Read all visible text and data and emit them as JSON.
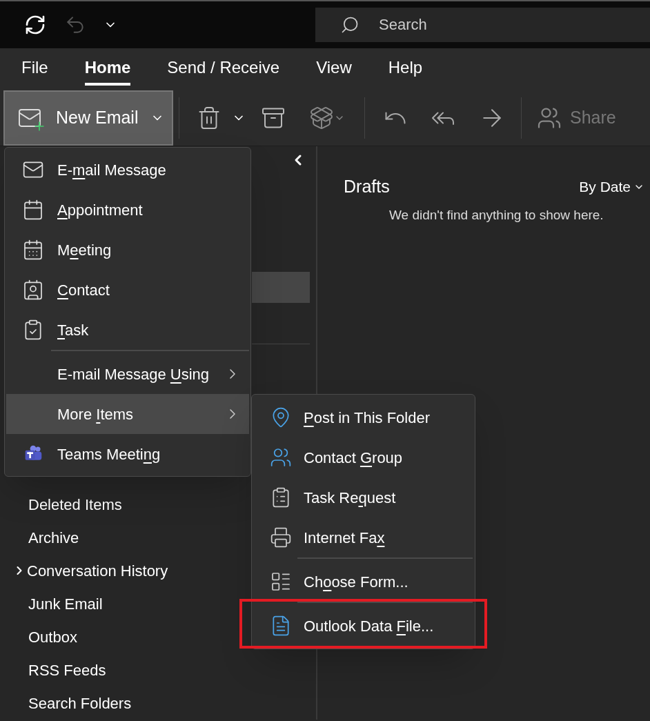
{
  "title_bar": {
    "search": {
      "placeholder": "Search"
    },
    "undo_disabled": true
  },
  "ribbon_tabs": [
    {
      "label": "File",
      "selected": false
    },
    {
      "label": "Home",
      "selected": true
    },
    {
      "label": "Send / Receive",
      "selected": false
    },
    {
      "label": "View",
      "selected": false
    },
    {
      "label": "Help",
      "selected": false
    }
  ],
  "toolbar": {
    "new_email": {
      "label": "New Email",
      "pressed": true
    },
    "share": {
      "label": "Share",
      "disabled": true
    }
  },
  "new_menu": {
    "items": [
      {
        "label": {
          "before": "E-",
          "key": "m",
          "after": "ail Message"
        },
        "selected": false,
        "submenu": false,
        "separator_before": false
      },
      {
        "label": {
          "key": "A",
          "after": "ppointment"
        },
        "selected": false,
        "submenu": false,
        "separator_before": false
      },
      {
        "label": {
          "before": "M",
          "key": "e",
          "after": "eting"
        },
        "selected": false,
        "submenu": false,
        "separator_before": false
      },
      {
        "label": {
          "key": "C",
          "after": "ontact"
        },
        "selected": false,
        "submenu": false,
        "separator_before": false
      },
      {
        "label": {
          "key": "T",
          "after": "ask"
        },
        "selected": false,
        "submenu": false,
        "separator_before": false
      },
      {
        "label": {
          "before": "E-mail Message ",
          "key": "U",
          "after": "sing"
        },
        "selected": false,
        "submenu": true,
        "separator_before": true
      },
      {
        "label": {
          "before": "More ",
          "key": "I",
          "after": "tems"
        },
        "selected": true,
        "submenu": true,
        "separator_before": false
      },
      {
        "label": {
          "before": "Teams Meeti",
          "key": "n",
          "after": "g"
        },
        "selected": false,
        "submenu": false,
        "separator_before": false
      }
    ]
  },
  "more_items_menu": {
    "items": [
      {
        "label": {
          "key": "P",
          "after": "ost in This Folder"
        },
        "separator_before": false,
        "highlighted": false
      },
      {
        "label": {
          "before": "Contact ",
          "key": "G",
          "after": "roup"
        },
        "separator_before": false,
        "highlighted": false
      },
      {
        "label": {
          "before": "Task Re",
          "key": "q",
          "after": "uest"
        },
        "separator_before": false,
        "highlighted": false
      },
      {
        "label": {
          "before": "Internet Fa",
          "key": "x"
        },
        "separator_before": false,
        "highlighted": false
      },
      {
        "label": {
          "before": "Ch",
          "key": "o",
          "after": "ose Form..."
        },
        "separator_before": true,
        "highlighted": false
      },
      {
        "label": {
          "before": "Outlook Data ",
          "key": "F",
          "after": "ile..."
        },
        "separator_before": true,
        "highlighted": true
      }
    ]
  },
  "folders": [
    {
      "label": "Deleted Items",
      "expandable": false
    },
    {
      "label": "Archive",
      "expandable": false
    },
    {
      "label": "Conversation History",
      "expandable": true
    },
    {
      "label": "Junk Email",
      "expandable": false
    },
    {
      "label": "Outbox",
      "expandable": false
    },
    {
      "label": "RSS Feeds",
      "expandable": false
    },
    {
      "label": "Search Folders",
      "expandable": false
    }
  ],
  "message_list": {
    "folder_title": "Drafts",
    "sort": "By Date",
    "empty_message": "We didn't find anything to show here."
  }
}
